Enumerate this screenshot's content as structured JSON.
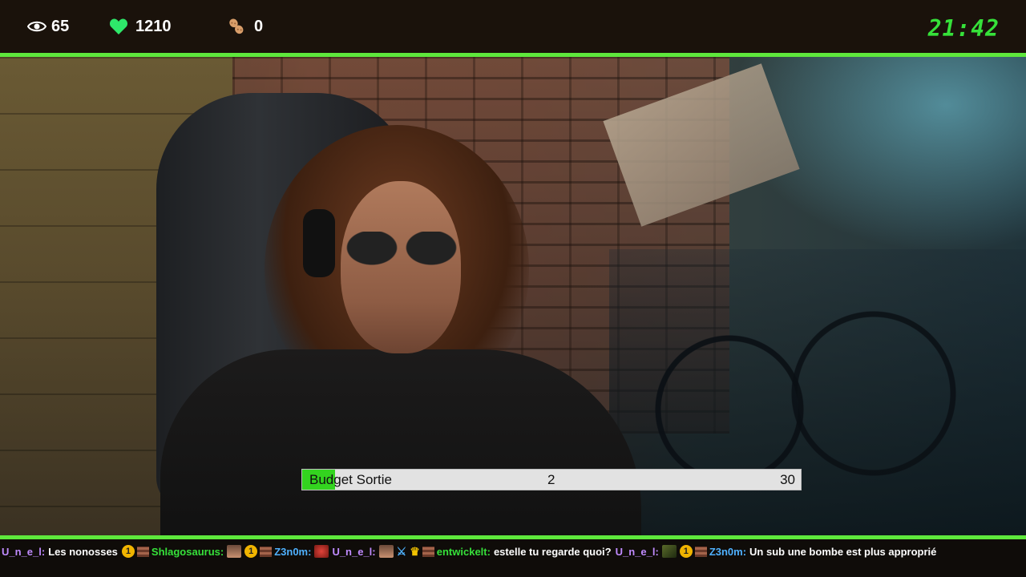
{
  "stats": {
    "viewers": "65",
    "followers": "1210",
    "peanuts": "0",
    "clock": "21:42",
    "colors": {
      "accent": "#5ee83c",
      "clock": "#36e13a",
      "heart": "#2ee86a",
      "peanut": "#d99e6a"
    }
  },
  "budget": {
    "label": "Budget Sortie",
    "current": "2",
    "max": "30",
    "fill_fraction": 0.0667,
    "fill_color": "#33d41f"
  },
  "chat": {
    "entries": [
      {
        "user": "U_n_e_l:",
        "user_color": "#c08bff",
        "message": "Les nonosses"
      },
      {
        "user": "Shlagosaurus:",
        "user_color": "#36e13a",
        "message": ""
      },
      {
        "user": "Z3n0m:",
        "user_color": "#4fb1ff",
        "message": ""
      },
      {
        "user": "U_n_e_l:",
        "user_color": "#c08bff",
        "message": ""
      },
      {
        "user": "entwickelt:",
        "user_color": "#36e13a",
        "message": "estelle tu regarde quoi?"
      },
      {
        "user": "U_n_e_l:",
        "user_color": "#c08bff",
        "message": ""
      },
      {
        "user": "Z3n0m:",
        "user_color": "#4fb1ff",
        "message": "Un sub une bombe est plus approprié"
      }
    ]
  }
}
